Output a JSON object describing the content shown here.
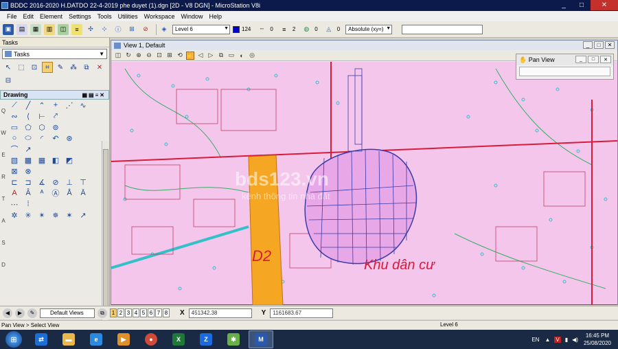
{
  "window": {
    "title": "BDDC 2016-2020 H.DATDO 22-4-2019 phe duyet (1).dgn [2D - V8 DGN] - MicroStation V8i",
    "min": "_",
    "max": "□",
    "close": "✕"
  },
  "menu": [
    "File",
    "Edit",
    "Element",
    "Settings",
    "Tools",
    "Utilities",
    "Workspace",
    "Window",
    "Help"
  ],
  "toolbar": {
    "level": "Level 6",
    "color_value": "124",
    "style_value": "0",
    "weight_value": "2",
    "class_value": "0",
    "transparency_value": "0",
    "snap_mode": "Absolute (xy=)",
    "colors": {
      "active_color": "#0000c8"
    }
  },
  "tasks": {
    "panel_title": "Tasks",
    "selected_task": "Tasks",
    "drawing_label": "Drawing",
    "row_letters": [
      "Q",
      "W",
      "E",
      "R",
      "T",
      "A",
      "S",
      "D"
    ]
  },
  "view": {
    "title": "View 1, Default"
  },
  "map": {
    "watermark_main": "bds123.vn",
    "watermark_sub": "kênh thông tin nhà đất",
    "label_d2": "D2",
    "label_khu": "Khu dân cư",
    "colors": {
      "background": "#f4c6ec",
      "road_orange": "#f5a623",
      "boundary_red": "#d81b3c",
      "parcels_blue": "#3a3aa8",
      "vegetation_cyan": "#33c0c8"
    }
  },
  "pan_view": {
    "title": "Pan View"
  },
  "view_bar": {
    "views_combo": "Default Views",
    "view_numbers": [
      "1",
      "2",
      "3",
      "4",
      "5",
      "6",
      "7",
      "8"
    ],
    "x_label": "X",
    "x_value": "451342.38",
    "y_label": "Y",
    "y_value": "1161683.67"
  },
  "status": {
    "message": "Pan View > Select View",
    "level": "Level 6"
  },
  "taskbar": {
    "lang": "EN",
    "time": "16:45 PM",
    "date": "25/08/2020",
    "apps": [
      "teamviewer",
      "explorer",
      "ie",
      "media",
      "chrome",
      "excel",
      "zalo",
      "gear-app",
      "microstation"
    ]
  }
}
